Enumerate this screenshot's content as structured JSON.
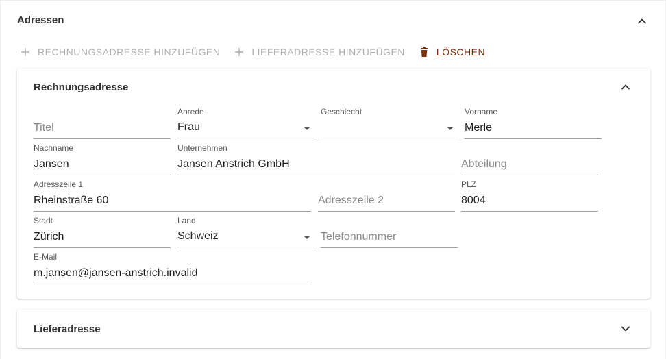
{
  "section": {
    "title": "Adressen"
  },
  "toolbar": {
    "add_billing_label": "RECHNUNGSADRESSE HINZUFÜGEN",
    "add_delivery_label": "LIEFERADRESSE HINZUFÜGEN",
    "delete_label": "LÖSCHEN"
  },
  "billing": {
    "title": "Rechnungsadresse",
    "fields": {
      "titel": {
        "placeholder": "Titel"
      },
      "anrede": {
        "label": "Anrede",
        "value": "Frau"
      },
      "geschlecht": {
        "label": "Geschlecht",
        "value": ""
      },
      "vorname": {
        "label": "Vorname",
        "value": "Merle"
      },
      "nachname": {
        "label": "Nachname",
        "value": "Jansen"
      },
      "unternehmen": {
        "label": "Unternehmen",
        "value": "Jansen Anstrich GmbH"
      },
      "abteilung": {
        "placeholder": "Abteilung"
      },
      "adresszeile1": {
        "label": "Adresszeile 1",
        "value": "Rheinstraße 60"
      },
      "adresszeile2": {
        "placeholder": "Adresszeile 2"
      },
      "plz": {
        "label": "PLZ",
        "value": "8004"
      },
      "stadt": {
        "label": "Stadt",
        "value": "Zürich"
      },
      "land": {
        "label": "Land",
        "value": "Schweiz"
      },
      "telefon": {
        "placeholder": "Telefonnummer"
      },
      "email": {
        "label": "E-Mail",
        "value": "m.jansen@jansen-anstrich.invalid"
      }
    }
  },
  "delivery": {
    "title": "Lieferadresse"
  },
  "icons": {
    "chevron_up": "chevron-up-icon",
    "chevron_down": "chevron-down-icon",
    "plus": "plus-icon",
    "trash": "trash-icon"
  },
  "colors": {
    "danger": "#7a2e0a",
    "disabled": "#b0b0b0"
  }
}
